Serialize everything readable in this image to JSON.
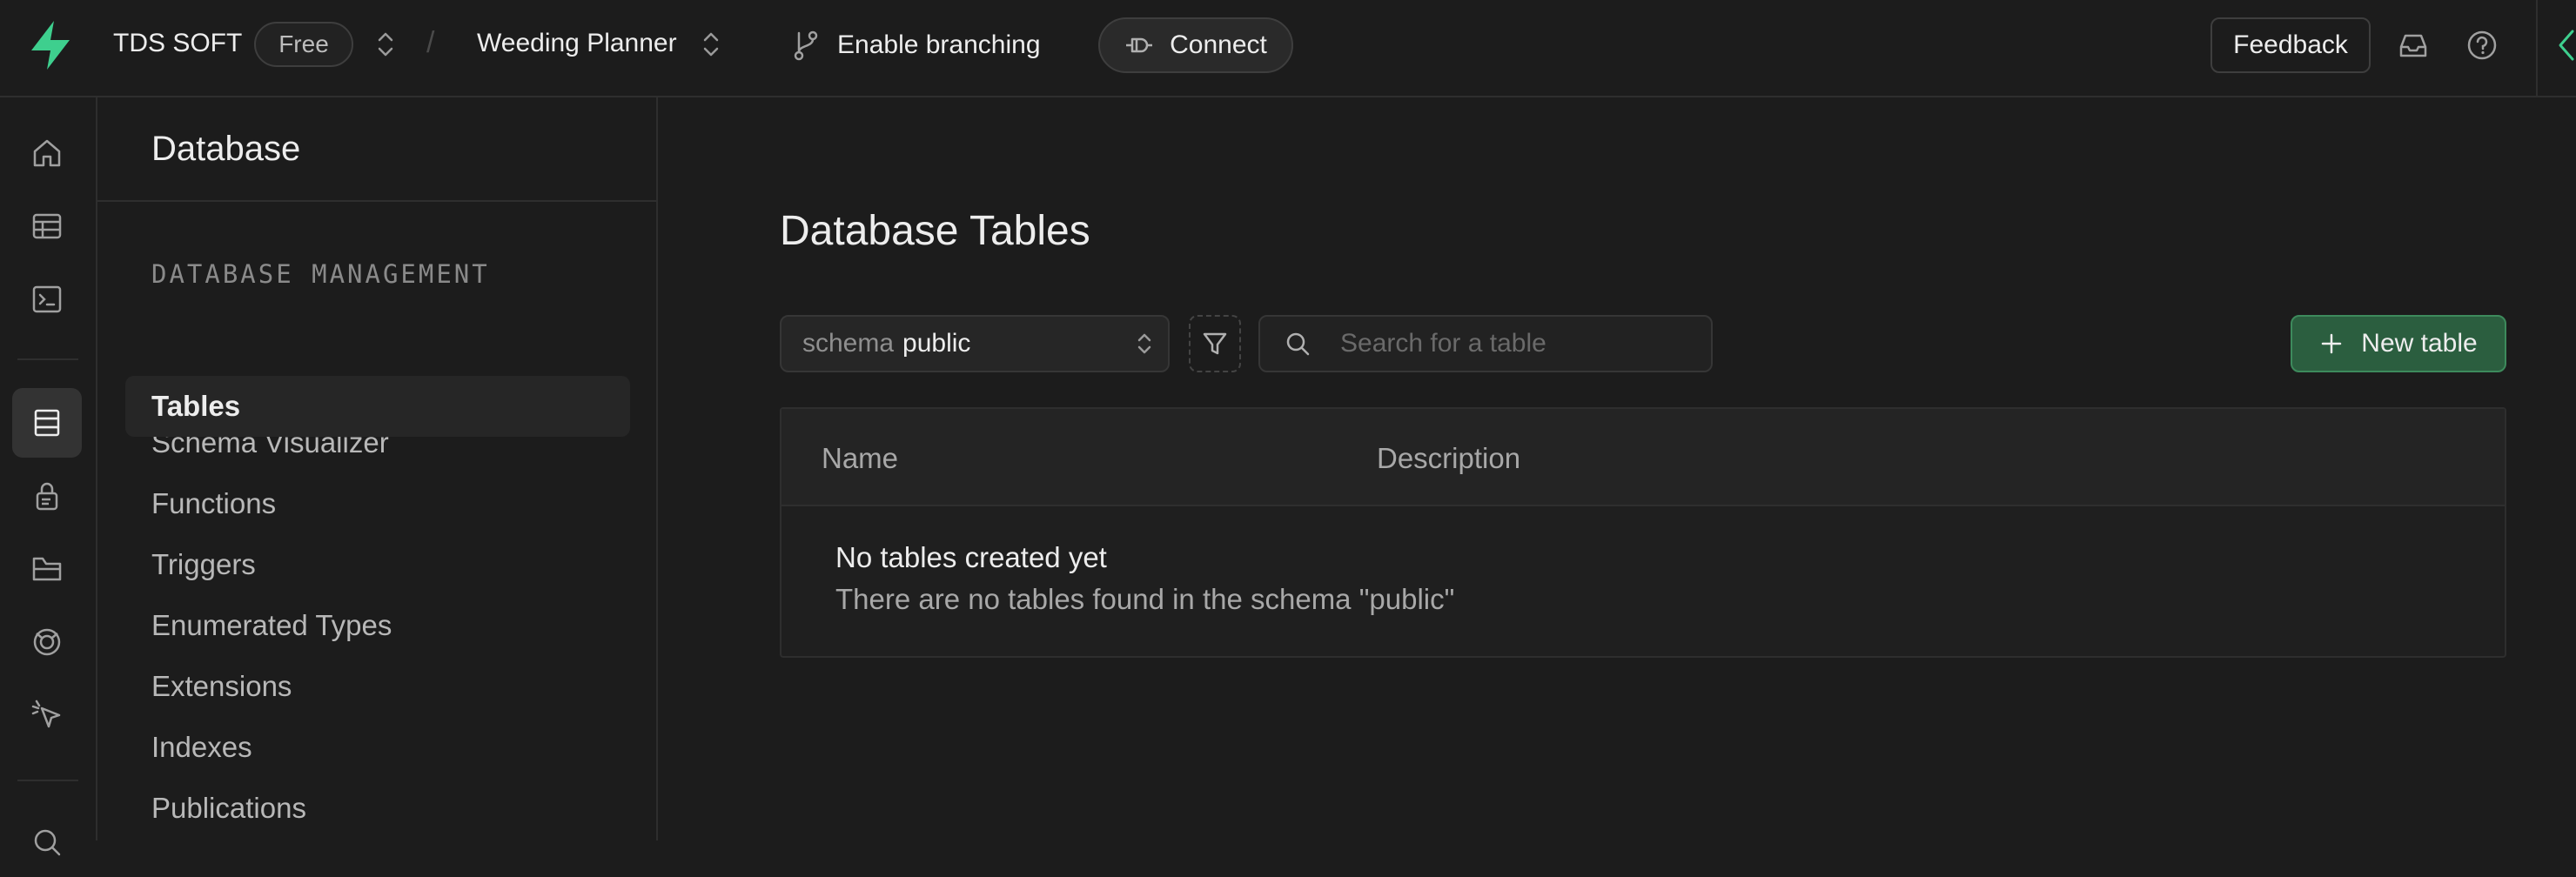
{
  "topbar": {
    "org_name": "TDS SOFT",
    "plan_badge": "Free",
    "separator": "/",
    "project_name": "Weeding Planner",
    "branch_label": "Enable branching",
    "connect_label": "Connect",
    "feedback_label": "Feedback",
    "icons": [
      "lightning-logo-icon",
      "chevron-updown-icon",
      "git-branch-icon",
      "plug-icon",
      "inbox-icon",
      "help-icon",
      "chevron-left-icon"
    ]
  },
  "rail": {
    "items": [
      "home-icon",
      "table-editor-icon",
      "sql-editor-icon",
      "database-icon",
      "auth-lock-icon",
      "storage-icon",
      "realtime-icon",
      "pointer-icon",
      "search-icon"
    ],
    "active": "database-icon"
  },
  "sidebar": {
    "title": "Database",
    "section_label": "DATABASE MANAGEMENT",
    "items": [
      {
        "label": "Schema Visualizer"
      },
      {
        "label": "Tables"
      },
      {
        "label": "Functions"
      },
      {
        "label": "Triggers"
      },
      {
        "label": "Enumerated Types"
      },
      {
        "label": "Extensions"
      },
      {
        "label": "Indexes"
      },
      {
        "label": "Publications"
      }
    ],
    "active_item": "Tables"
  },
  "main": {
    "title": "Database Tables",
    "schema_label": "schema",
    "schema_value": "public",
    "search_placeholder": "Search for a table",
    "new_table_label": "New table",
    "table": {
      "columns": [
        "Name",
        "Description"
      ],
      "empty_title": "No tables created yet",
      "empty_desc": "There are no tables found in the schema \"public\""
    }
  },
  "colors": {
    "background": "#1c1c1c",
    "border": "#2e2e2e",
    "brand_green": "#3ecf8e",
    "primary_button": "#2b5e3f"
  }
}
